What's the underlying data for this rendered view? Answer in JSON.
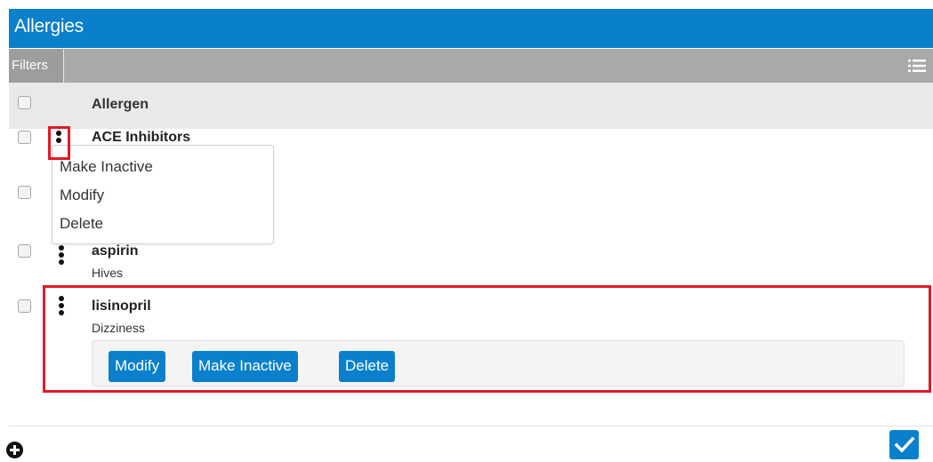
{
  "header": {
    "title": "Allergies"
  },
  "toolbar": {
    "filters_label": "Filters",
    "list_icon": "list-icon"
  },
  "table": {
    "column_header": "Allergen"
  },
  "allergies": [
    {
      "name": "ACE Inhibitors",
      "reaction": ""
    },
    {
      "name": "",
      "reaction": ""
    },
    {
      "name": "aspirin",
      "reaction": "Hives"
    },
    {
      "name": "lisinopril",
      "reaction": "Dizziness"
    }
  ],
  "context_menu": {
    "items": [
      "Make Inactive",
      "Modify",
      "Delete"
    ]
  },
  "row_actions": {
    "modify": "Modify",
    "make_inactive": "Make Inactive",
    "delete": "Delete"
  },
  "footer": {
    "add_icon": "plus-circle-icon",
    "confirm_icon": "checkmark-icon"
  },
  "colors": {
    "accent": "#0a80cc",
    "highlight": "#e01b24",
    "filter_bar": "#a9a9a9",
    "header_row": "#e9e9e9"
  }
}
